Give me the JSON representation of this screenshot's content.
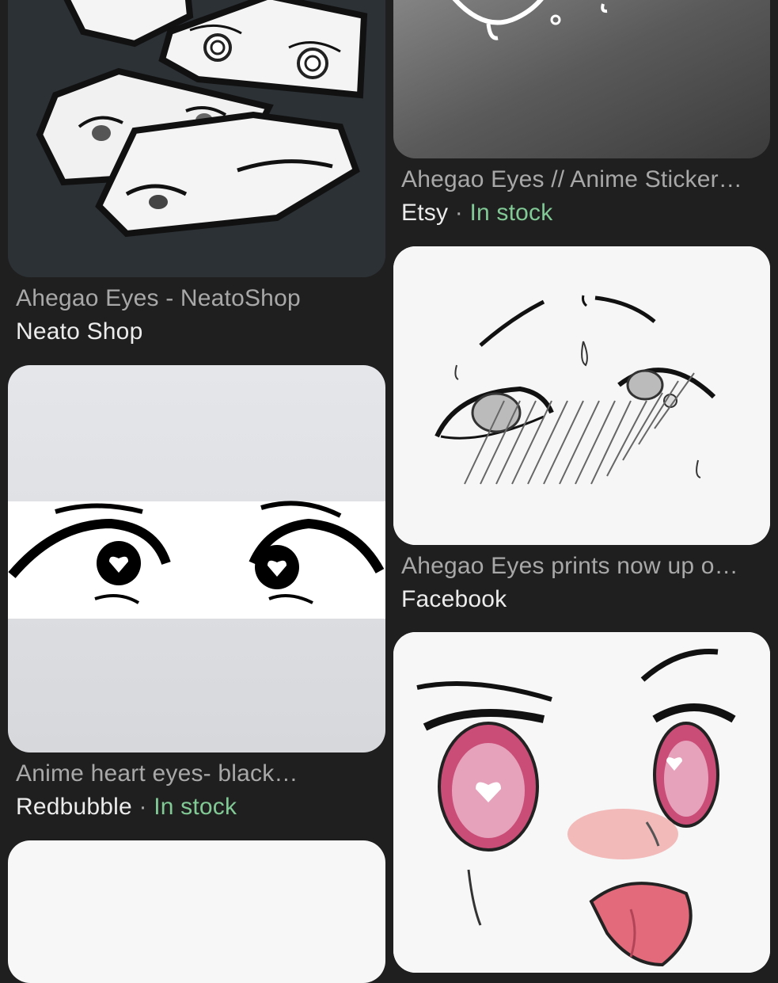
{
  "results": [
    {
      "title": "Ahegao Eyes - NeatoShop",
      "source": "Neato Shop",
      "separator": "",
      "availability": "",
      "image": "anime-eyes-stickers-dark"
    },
    {
      "title": "Ahegao Eyes // Anime Sticker…",
      "source": "Etsy",
      "separator": "·",
      "availability": "In stock",
      "image": "anime-eyes-sticker-gray"
    },
    {
      "title": "Ahegao Eyes prints now up o…",
      "source": "Facebook",
      "separator": "",
      "availability": "",
      "image": "anime-eyes-sketch"
    },
    {
      "title": "Anime heart eyes- black…",
      "source": "Redbubble",
      "separator": "·",
      "availability": "In stock",
      "image": "anime-heart-eyes-black"
    },
    {
      "title": "",
      "source": "",
      "separator": "",
      "availability": "",
      "image": "anime-face-pink-eyes"
    },
    {
      "title": "",
      "source": "",
      "separator": "",
      "availability": "",
      "image": "blank-white-thumbnail"
    }
  ],
  "colors": {
    "background": "#1f1f1f",
    "title": "#a8a8a8",
    "source": "#ececec",
    "in_stock": "#81c995"
  }
}
